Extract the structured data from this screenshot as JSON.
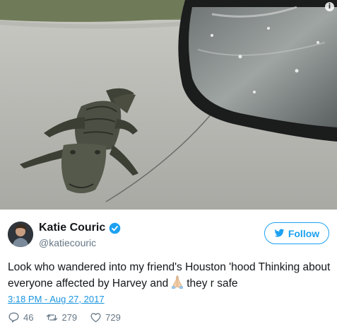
{
  "tweet": {
    "display_name": "Katie Couric",
    "handle": "@katiecouric",
    "follow_label": "Follow",
    "text_before_emoji": "Look who wandered into my friend's Houston 'hood Thinking about everyone affected by Harvey and",
    "text_after_emoji": "they r safe",
    "emoji": "praying-hands-emoji",
    "timestamp": "3:18 PM - Aug 27, 2017",
    "replies": "46",
    "retweets": "279",
    "likes": "729"
  },
  "colors": {
    "accent": "#1da1f2",
    "link": "#1b95e0",
    "secondary_text": "#657786"
  },
  "icons": {
    "info": "info-icon",
    "verified": "verified-badge-icon",
    "follow": "twitter-bird-icon",
    "reply": "reply-icon",
    "retweet": "retweet-icon",
    "like": "heart-icon"
  }
}
